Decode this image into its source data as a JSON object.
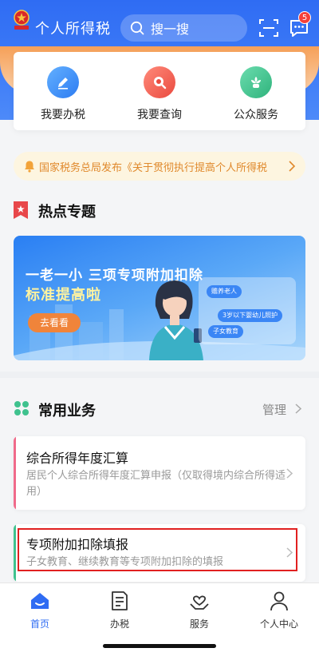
{
  "header": {
    "app_title": "个人所得税",
    "search_placeholder": "搜一搜",
    "message_count": "5"
  },
  "quick_actions": [
    {
      "label": "我要办税",
      "icon": "edit-icon",
      "color": "#3b8cf5"
    },
    {
      "label": "我要查询",
      "icon": "search-icon",
      "color": "#f05a4f"
    },
    {
      "label": "公众服务",
      "icon": "flower-icon",
      "color": "#38c08a"
    }
  ],
  "notice": {
    "text": "国家税务总局发布《关于贯彻执行提高个人所得税"
  },
  "hot_topics": {
    "title": "热点专题",
    "banner": {
      "headline": "一老一小 三项专项附加扣除",
      "subheadline": "标准提高啦",
      "button": "去看看",
      "chips": [
        "赡养老人",
        "3岁以下婴幼儿照护",
        "子女教育"
      ]
    }
  },
  "common_business": {
    "title": "常用业务",
    "manage_label": "管理",
    "items": [
      {
        "title": "综合所得年度汇算",
        "desc": "居民个人综合所得年度汇算申报（仅取得境内综合所得适用）",
        "accent": "#f06a8a"
      },
      {
        "title": "专项附加扣除填报",
        "desc": "子女教育、继续教育等专项附加扣除的填报",
        "accent": "#3fc28e"
      }
    ]
  },
  "tabbar": {
    "items": [
      {
        "label": "首页",
        "active": true
      },
      {
        "label": "办税",
        "active": false
      },
      {
        "label": "服务",
        "active": false
      },
      {
        "label": "个人中心",
        "active": false
      }
    ]
  },
  "colors": {
    "primary": "#2f6cf3",
    "notice_text": "#e0892c",
    "highlight_border": "#e12020"
  }
}
